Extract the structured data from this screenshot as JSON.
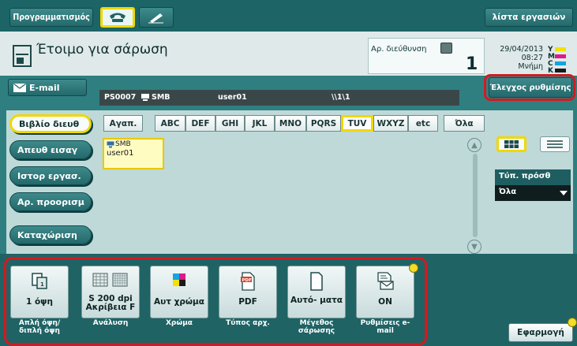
{
  "topbar": {
    "program_label": "Προγραμματισμός",
    "fax_tab_icon": "phone-icon",
    "handwriting_tab_icon": "pen-icon",
    "job_list_label": "λίστα εργασιών"
  },
  "status": {
    "title": "Έτοιμο για σάρωση",
    "address_label": "Αρ. διεύθυνση",
    "address_count": "1",
    "date": "29/04/2013",
    "time": "08:27",
    "memory_label": "Μνήμη",
    "toner_letters": [
      "Y",
      "M",
      "C",
      "K"
    ],
    "toner_colors": [
      "#f2e200",
      "#e0188a",
      "#14a4e0",
      "#1a1a1a"
    ]
  },
  "email_tab": {
    "label": "E-mail"
  },
  "path_bar": {
    "server": "PS0007",
    "protocol": "SMB",
    "user": "user01",
    "path": "\\\\1\\1"
  },
  "check_settings": {
    "label": "Έλεγχος ρυθμίσης"
  },
  "left_nav": {
    "items": [
      {
        "label": "Βιβλίο διευθ"
      },
      {
        "label": "Απευθ εισαγ"
      },
      {
        "label": "Ιστορ εργασ."
      },
      {
        "label": "Αρ. προορισμ"
      },
      {
        "label": "Καταχώριση"
      }
    ]
  },
  "filters": [
    "Αγαπ.",
    "ABC",
    "DEF",
    "GHI",
    "JKL",
    "MNO",
    "PQRS",
    "TUV",
    "WXYZ",
    "etc",
    "Όλα"
  ],
  "selected_filter": "TUV",
  "destination": {
    "type": "SMB",
    "name": "user01"
  },
  "sort": {
    "label": "Τύπ. πρόσθ",
    "value": "Όλα"
  },
  "functions": [
    {
      "value": "1 όψη",
      "caption": "Απλή όψη/ διπλή όψη",
      "icon": "simplex-page-icon"
    },
    {
      "value": "S 200 dpi Ακρίβεια F",
      "caption": "Ανάλυση",
      "icon": "resolution-icon"
    },
    {
      "value": "Αυτ χρώμα",
      "caption": "Χρώμα",
      "icon": "color-icon"
    },
    {
      "value": "PDF",
      "caption": "Τύπος αρχ.",
      "icon": "pdf-file-icon"
    },
    {
      "value": "Αυτό- ματα",
      "caption": "Μέγεθος σάρωσης",
      "icon": "page-size-icon"
    },
    {
      "value": "ON",
      "caption": "Ρυθμίσεις e-mail",
      "icon": "email-settings-icon"
    }
  ],
  "apply_button": {
    "label": "Εφαρμογή"
  }
}
